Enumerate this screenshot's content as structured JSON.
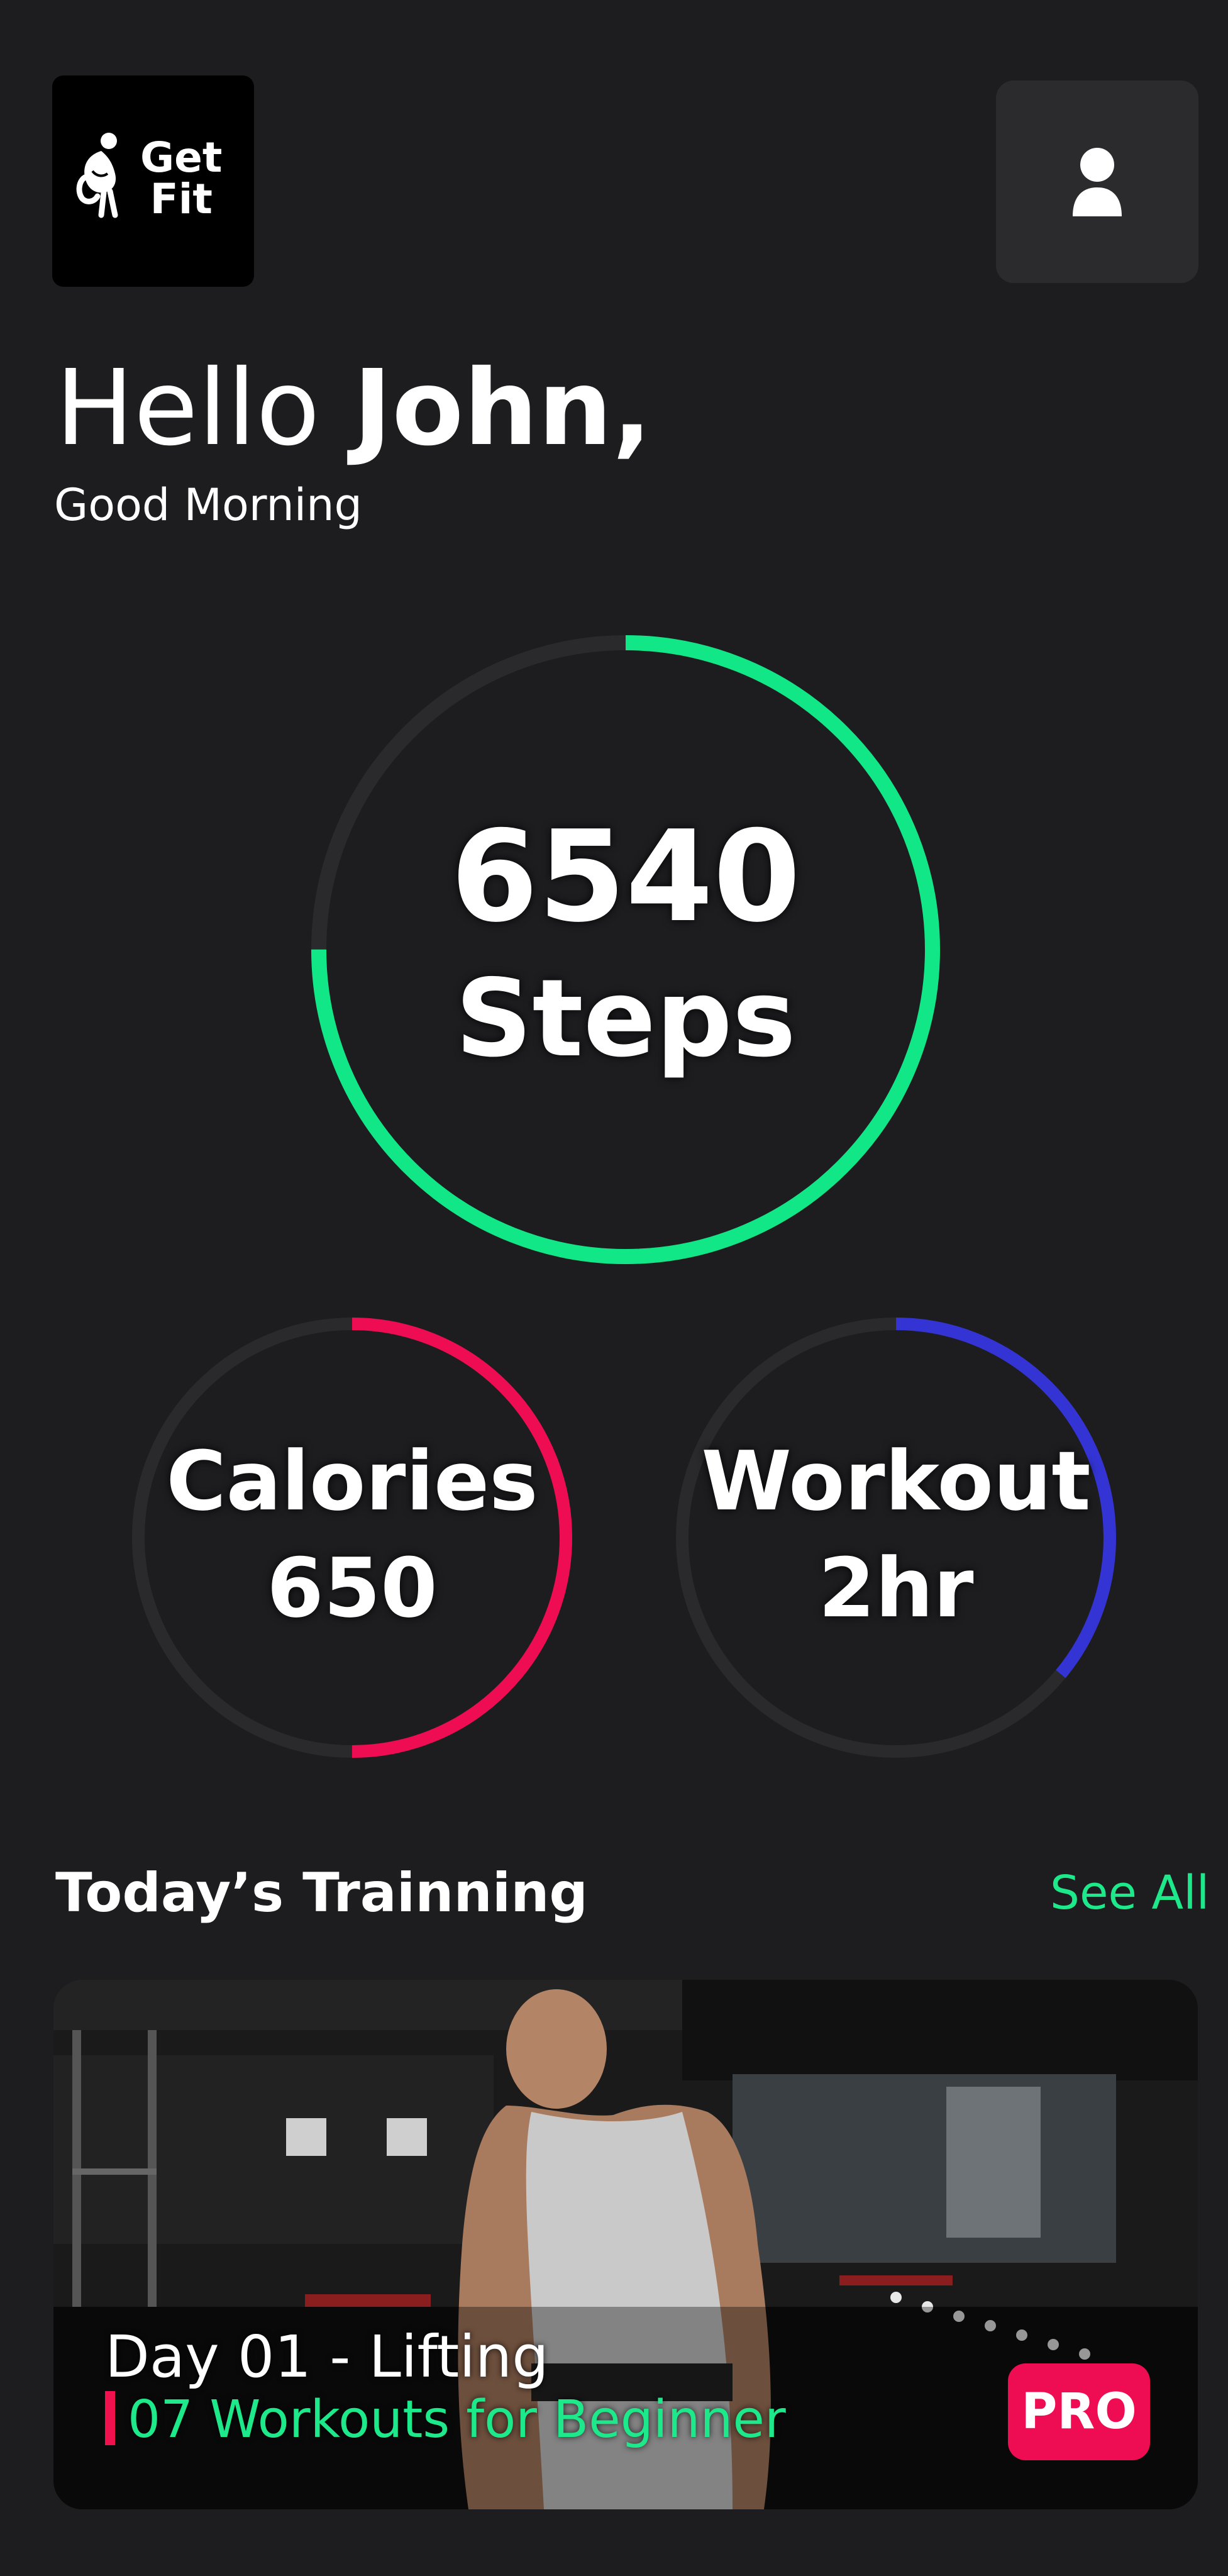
{
  "header": {
    "logo_line1": "Get",
    "logo_line2": "Fit",
    "profile_icon": "user-icon"
  },
  "greeting": {
    "hello_prefix": "Hello ",
    "name": "John,",
    "subtitle": "Good Morning"
  },
  "stats": {
    "steps": {
      "value": "6540",
      "unit": "Steps",
      "progress": 0.75,
      "color": "#12e787"
    },
    "calories": {
      "label": "Calories",
      "value": "650",
      "progress": 0.5,
      "color": "#ee0d52"
    },
    "workout": {
      "label": "Workout",
      "value": "2hr",
      "progress": 0.36,
      "color": "#3434d4"
    },
    "track_color": "#2a2a2d"
  },
  "training": {
    "section_title": "Today’s Trainning",
    "see_all": "See All",
    "card": {
      "title": "Day 01 - Lifting",
      "subtitle": "07 Workouts  for Beginner",
      "badge": "PRO"
    }
  },
  "colors": {
    "background": "#1d1d20",
    "accent_green": "#1de98b",
    "accent_pink": "#ee0d52"
  }
}
